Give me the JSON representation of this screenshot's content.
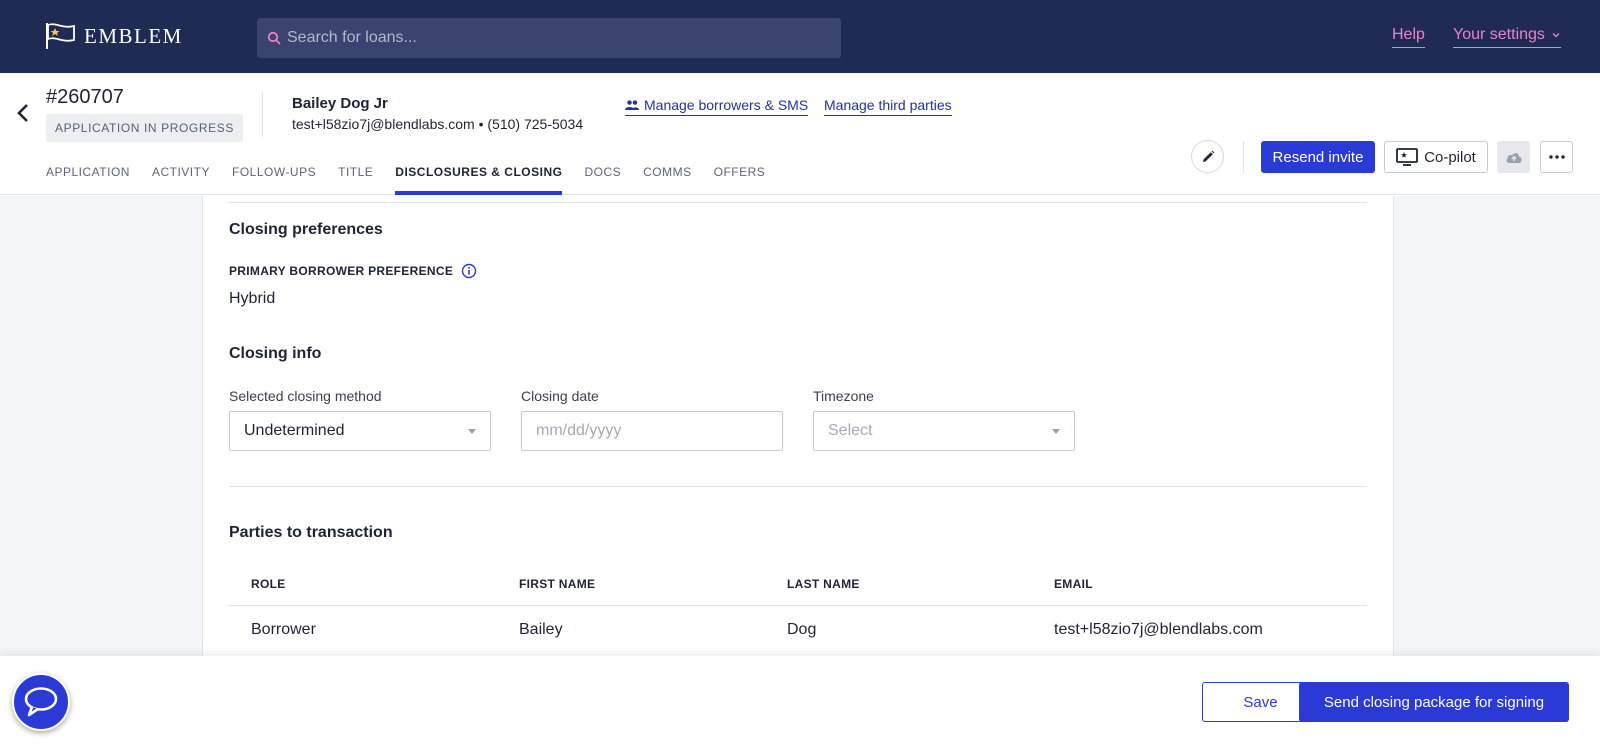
{
  "topnav": {
    "logo_text": "EMBLEM",
    "search_placeholder": "Search for loans...",
    "help_label": "Help",
    "settings_label": "Your settings"
  },
  "loan": {
    "id": "#260707",
    "status": "APPLICATION IN PROGRESS",
    "borrower_name": "Bailey Dog Jr",
    "borrower_contact": "test+l58zio7j@blendlabs.com • (510) 725-5034"
  },
  "links": {
    "manage_borrowers": "Manage borrowers & SMS",
    "manage_third_parties": "Manage third parties"
  },
  "tabs": [
    {
      "label": "APPLICATION"
    },
    {
      "label": "ACTIVITY"
    },
    {
      "label": "FOLLOW-UPS"
    },
    {
      "label": "TITLE"
    },
    {
      "label": "DISCLOSURES & CLOSING"
    },
    {
      "label": "DOCS"
    },
    {
      "label": "COMMS"
    },
    {
      "label": "OFFERS"
    }
  ],
  "active_tab": "DISCLOSURES & CLOSING",
  "actions": {
    "resend_invite": "Resend invite",
    "copilot": "Co-pilot"
  },
  "closing_preferences": {
    "title": "Closing preferences",
    "label": "PRIMARY BORROWER PREFERENCE",
    "value": "Hybrid"
  },
  "closing_info": {
    "title": "Closing info",
    "method_label": "Selected closing method",
    "method_value": "Undetermined",
    "date_label": "Closing date",
    "date_placeholder": "mm/dd/yyyy",
    "timezone_label": "Timezone",
    "timezone_placeholder": "Select"
  },
  "parties": {
    "title": "Parties to transaction",
    "headers": [
      "ROLE",
      "FIRST NAME",
      "LAST NAME",
      "EMAIL"
    ],
    "rows": [
      [
        "Borrower",
        "Bailey",
        "Dog",
        "test+l58zio7j@blendlabs.com"
      ]
    ]
  },
  "footer": {
    "save_label": "Save",
    "send_label": "Send closing package for signing"
  },
  "colors": {
    "nav_bg": "#1f2a55",
    "accent": "#2a3ad6",
    "nav_link": "#e783c9"
  },
  "icons": {
    "logo": "flag-icon",
    "search": "search-icon",
    "chevron": "chevron-down-icon",
    "back": "chevron-left-icon",
    "people": "people-icon",
    "edit": "pencil-icon",
    "copilot": "screen-star-icon",
    "cloud": "cloud-upload-icon",
    "more": "ellipsis-icon",
    "info": "info-icon",
    "chat": "chat-bubble-icon"
  }
}
